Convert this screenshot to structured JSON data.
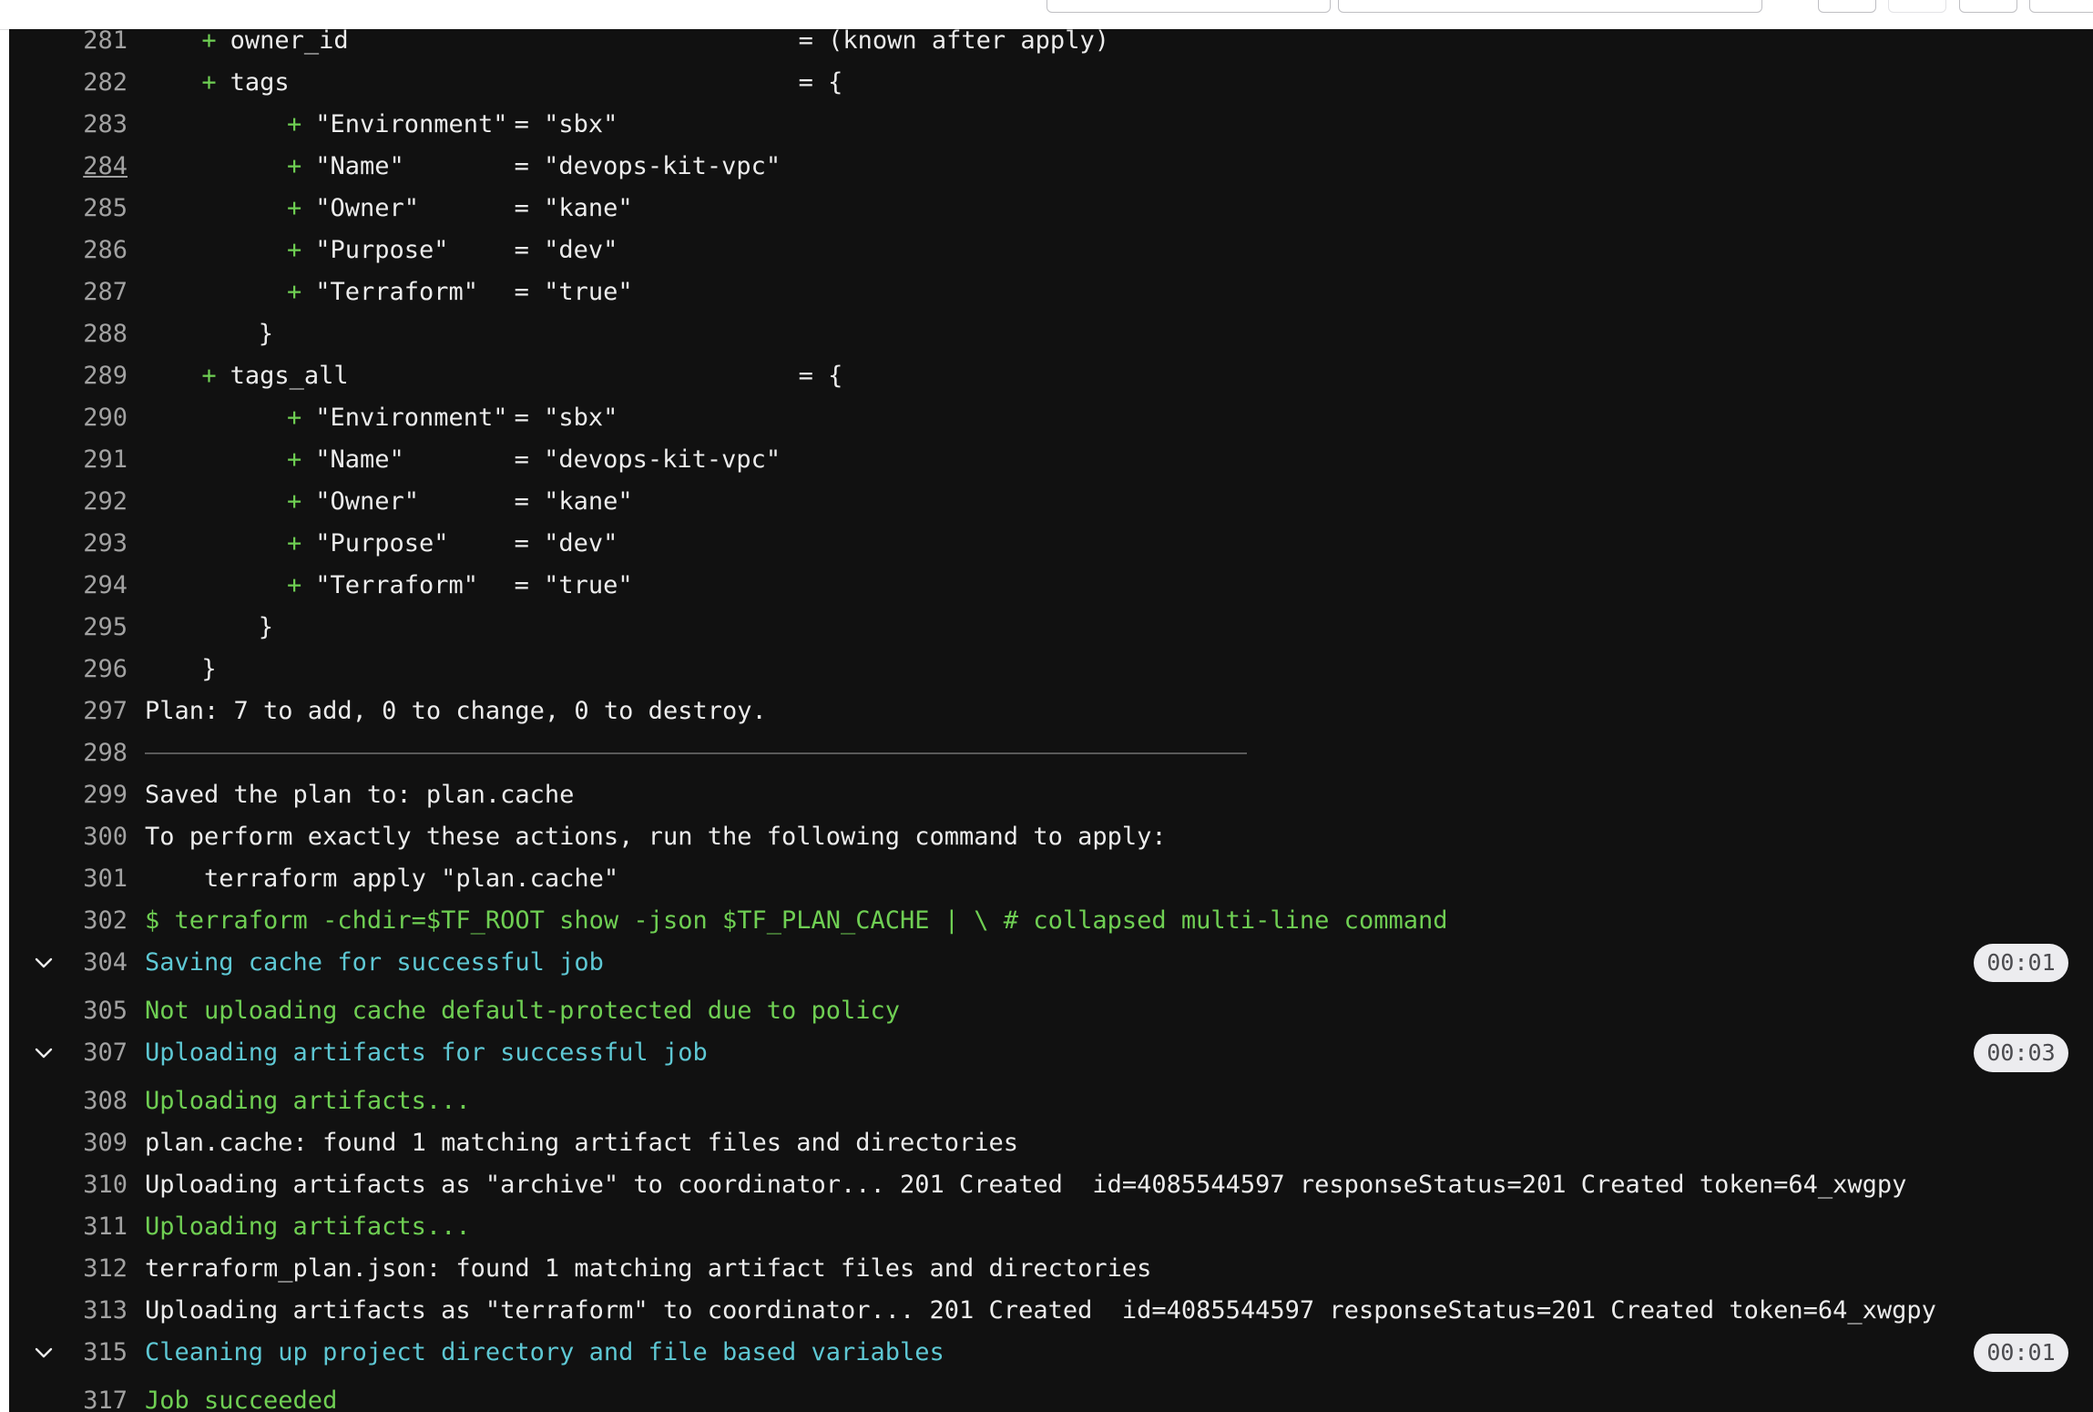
{
  "log": {
    "lines": [
      {
        "num": "281",
        "t": "plus-kv",
        "indent": 1,
        "key": "owner_id",
        "eq": "= (known after apply)"
      },
      {
        "num": "282",
        "t": "plus-kv",
        "indent": 1,
        "key": "tags",
        "eq": "= {"
      },
      {
        "num": "283",
        "t": "plus-tag",
        "key": "\"Environment\"",
        "val": "= \"sbx\""
      },
      {
        "num": "284",
        "t": "plus-tag",
        "key": "\"Name\"",
        "val": "= \"devops-kit-vpc\"",
        "underline": true
      },
      {
        "num": "285",
        "t": "plus-tag",
        "key": "\"Owner\"",
        "val": "= \"kane\""
      },
      {
        "num": "286",
        "t": "plus-tag",
        "key": "\"Purpose\"",
        "val": "= \"dev\""
      },
      {
        "num": "287",
        "t": "plus-tag",
        "key": "\"Terraform\"",
        "val": "= \"true\""
      },
      {
        "num": "288",
        "t": "brace",
        "indent": 2,
        "text": "}"
      },
      {
        "num": "289",
        "t": "plus-kv",
        "indent": 1,
        "key": "tags_all",
        "eq": "= {"
      },
      {
        "num": "290",
        "t": "plus-tag",
        "key": "\"Environment\"",
        "val": "= \"sbx\""
      },
      {
        "num": "291",
        "t": "plus-tag",
        "key": "\"Name\"",
        "val": "= \"devops-kit-vpc\""
      },
      {
        "num": "292",
        "t": "plus-tag",
        "key": "\"Owner\"",
        "val": "= \"kane\""
      },
      {
        "num": "293",
        "t": "plus-tag",
        "key": "\"Purpose\"",
        "val": "= \"dev\""
      },
      {
        "num": "294",
        "t": "plus-tag",
        "key": "\"Terraform\"",
        "val": "= \"true\""
      },
      {
        "num": "295",
        "t": "brace",
        "indent": 2,
        "text": "}"
      },
      {
        "num": "296",
        "t": "brace",
        "indent": 1,
        "text": "}"
      },
      {
        "num": "297",
        "t": "text",
        "color": "white",
        "text": "Plan: 7 to add, 0 to change, 0 to destroy."
      },
      {
        "num": "298",
        "t": "sep"
      },
      {
        "num": "299",
        "t": "text",
        "color": "white",
        "text": "Saved the plan to: plan.cache"
      },
      {
        "num": "300",
        "t": "text",
        "color": "white",
        "text": "To perform exactly these actions, run the following command to apply:"
      },
      {
        "num": "301",
        "t": "text",
        "color": "white",
        "text": "    terraform apply \"plan.cache\""
      },
      {
        "num": "302",
        "t": "text",
        "color": "green",
        "text": "$ terraform -chdir=$TF_ROOT show -json $TF_PLAN_CACHE | \\ # collapsed multi-line command"
      },
      {
        "num": "304",
        "t": "section",
        "text": "Saving cache for successful job",
        "duration": "00:01"
      },
      {
        "num": "305",
        "t": "text",
        "color": "green",
        "text": "Not uploading cache default-protected due to policy"
      },
      {
        "num": "307",
        "t": "section",
        "text": "Uploading artifacts for successful job",
        "duration": "00:03"
      },
      {
        "num": "308",
        "t": "text",
        "color": "green",
        "text": "Uploading artifacts..."
      },
      {
        "num": "309",
        "t": "text",
        "color": "white",
        "text": "plan.cache: found 1 matching artifact files and directories"
      },
      {
        "num": "310",
        "t": "text",
        "color": "white",
        "text": "Uploading artifacts as \"archive\" to coordinator... 201 Created  id=4085544597 responseStatus=201 Created token=64_xwgpy"
      },
      {
        "num": "311",
        "t": "text",
        "color": "green",
        "text": "Uploading artifacts..."
      },
      {
        "num": "312",
        "t": "text",
        "color": "white",
        "text": "terraform_plan.json: found 1 matching artifact files and directories"
      },
      {
        "num": "313",
        "t": "text",
        "color": "white",
        "text": "Uploading artifacts as \"terraform\" to coordinator... 201 Created  id=4085544597 responseStatus=201 Created token=64_xwgpy"
      },
      {
        "num": "315",
        "t": "section",
        "text": "Cleaning up project directory and file based variables",
        "duration": "00:01"
      },
      {
        "num": "317",
        "t": "text",
        "color": "green",
        "text": "Job succeeded"
      }
    ],
    "plus_sign": "+"
  },
  "colors": {
    "background": "#111111",
    "text": "#ececec",
    "line_number": "#a2a2a2",
    "green": "#6fcf53",
    "cyan": "#5ec8d4",
    "badge_bg": "#ececef"
  },
  "icons": {
    "section_toggle": "chevron-down-icon"
  }
}
